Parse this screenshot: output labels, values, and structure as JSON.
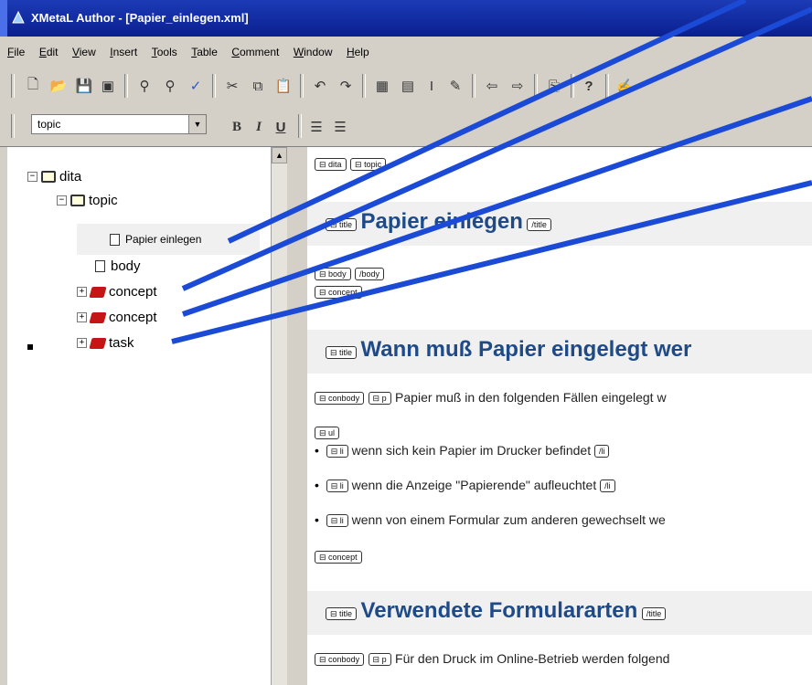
{
  "window": {
    "title": "XMetaL Author - [Papier_einlegen.xml]"
  },
  "menu": [
    "File",
    "Edit",
    "View",
    "Insert",
    "Tools",
    "Table",
    "Comment",
    "Window",
    "Help"
  ],
  "toolbar": {
    "style_value": "topic",
    "bold": "B",
    "italic": "I",
    "underline": "U",
    "help": "?"
  },
  "tree": {
    "nodes": [
      {
        "label": "dita",
        "icon": "book-icon"
      },
      {
        "label": "topic",
        "icon": "book-icon"
      },
      {
        "label": "Papier einlegen",
        "icon": "page-icon"
      },
      {
        "label": "body",
        "icon": "page-icon"
      },
      {
        "label": "concept",
        "icon": "red-book-icon"
      },
      {
        "label": "concept",
        "icon": "red-book-icon"
      },
      {
        "label": "task",
        "icon": "red-book-icon"
      }
    ]
  },
  "doc": {
    "breadcrumb": [
      "dita",
      "topic"
    ],
    "title_tag": "title",
    "title_close": "/title",
    "title": "Papier einlegen",
    "body_open": "body",
    "body_close": "/body",
    "concept": "concept",
    "h2": "Wann muß Papier eingelegt wer",
    "conbody": "conbody",
    "p": "p",
    "p1": "Papier muß in den folgenden Fällen eingelegt w",
    "ul": "ul",
    "li": "li",
    "li_close": "/li",
    "items": [
      "wenn sich kein Papier im Drucker befindet",
      "wenn die Anzeige \"Papierende\" aufleuchtet",
      "wenn von einem Formular zum anderen gewechselt we"
    ],
    "concept_close": "concept",
    "h3": "Verwendete Formulararten",
    "p2": "Für den Druck im Online-Betrieb werden folgend"
  },
  "colors": {
    "annotation_line": "#1a4ad6",
    "heading": "#1f4a88",
    "desktop": "#1a1aa8"
  }
}
